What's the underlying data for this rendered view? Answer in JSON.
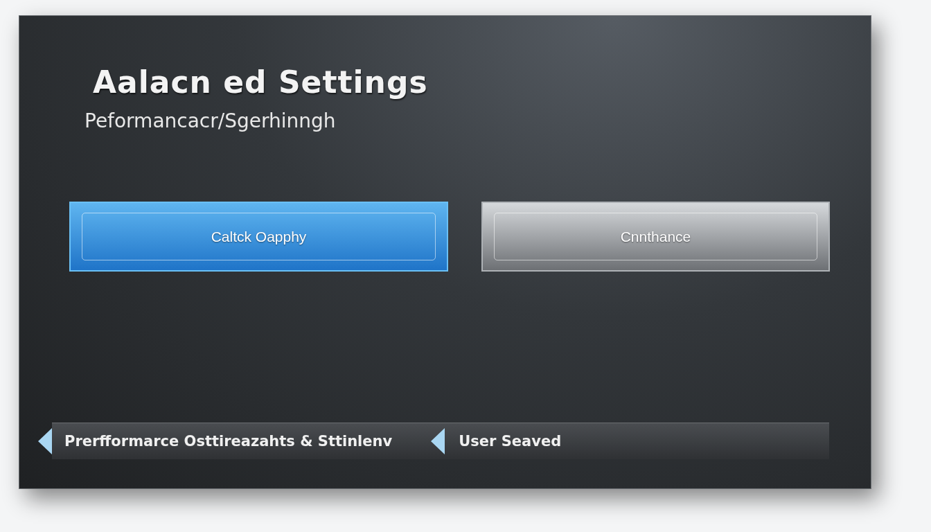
{
  "header": {
    "title": "Aalacn ed Settings",
    "subtitle": "Peformancacr/Sgerhinngh"
  },
  "buttons": [
    {
      "label": "Caltck Oapphy",
      "kind": "primary"
    },
    {
      "label": "Cnnthance",
      "kind": "secondary"
    }
  ],
  "status_bar": [
    {
      "text": "Prerfformarce Osttireazahts & Sttinlenv"
    },
    {
      "text": "User Seaved"
    }
  ]
}
